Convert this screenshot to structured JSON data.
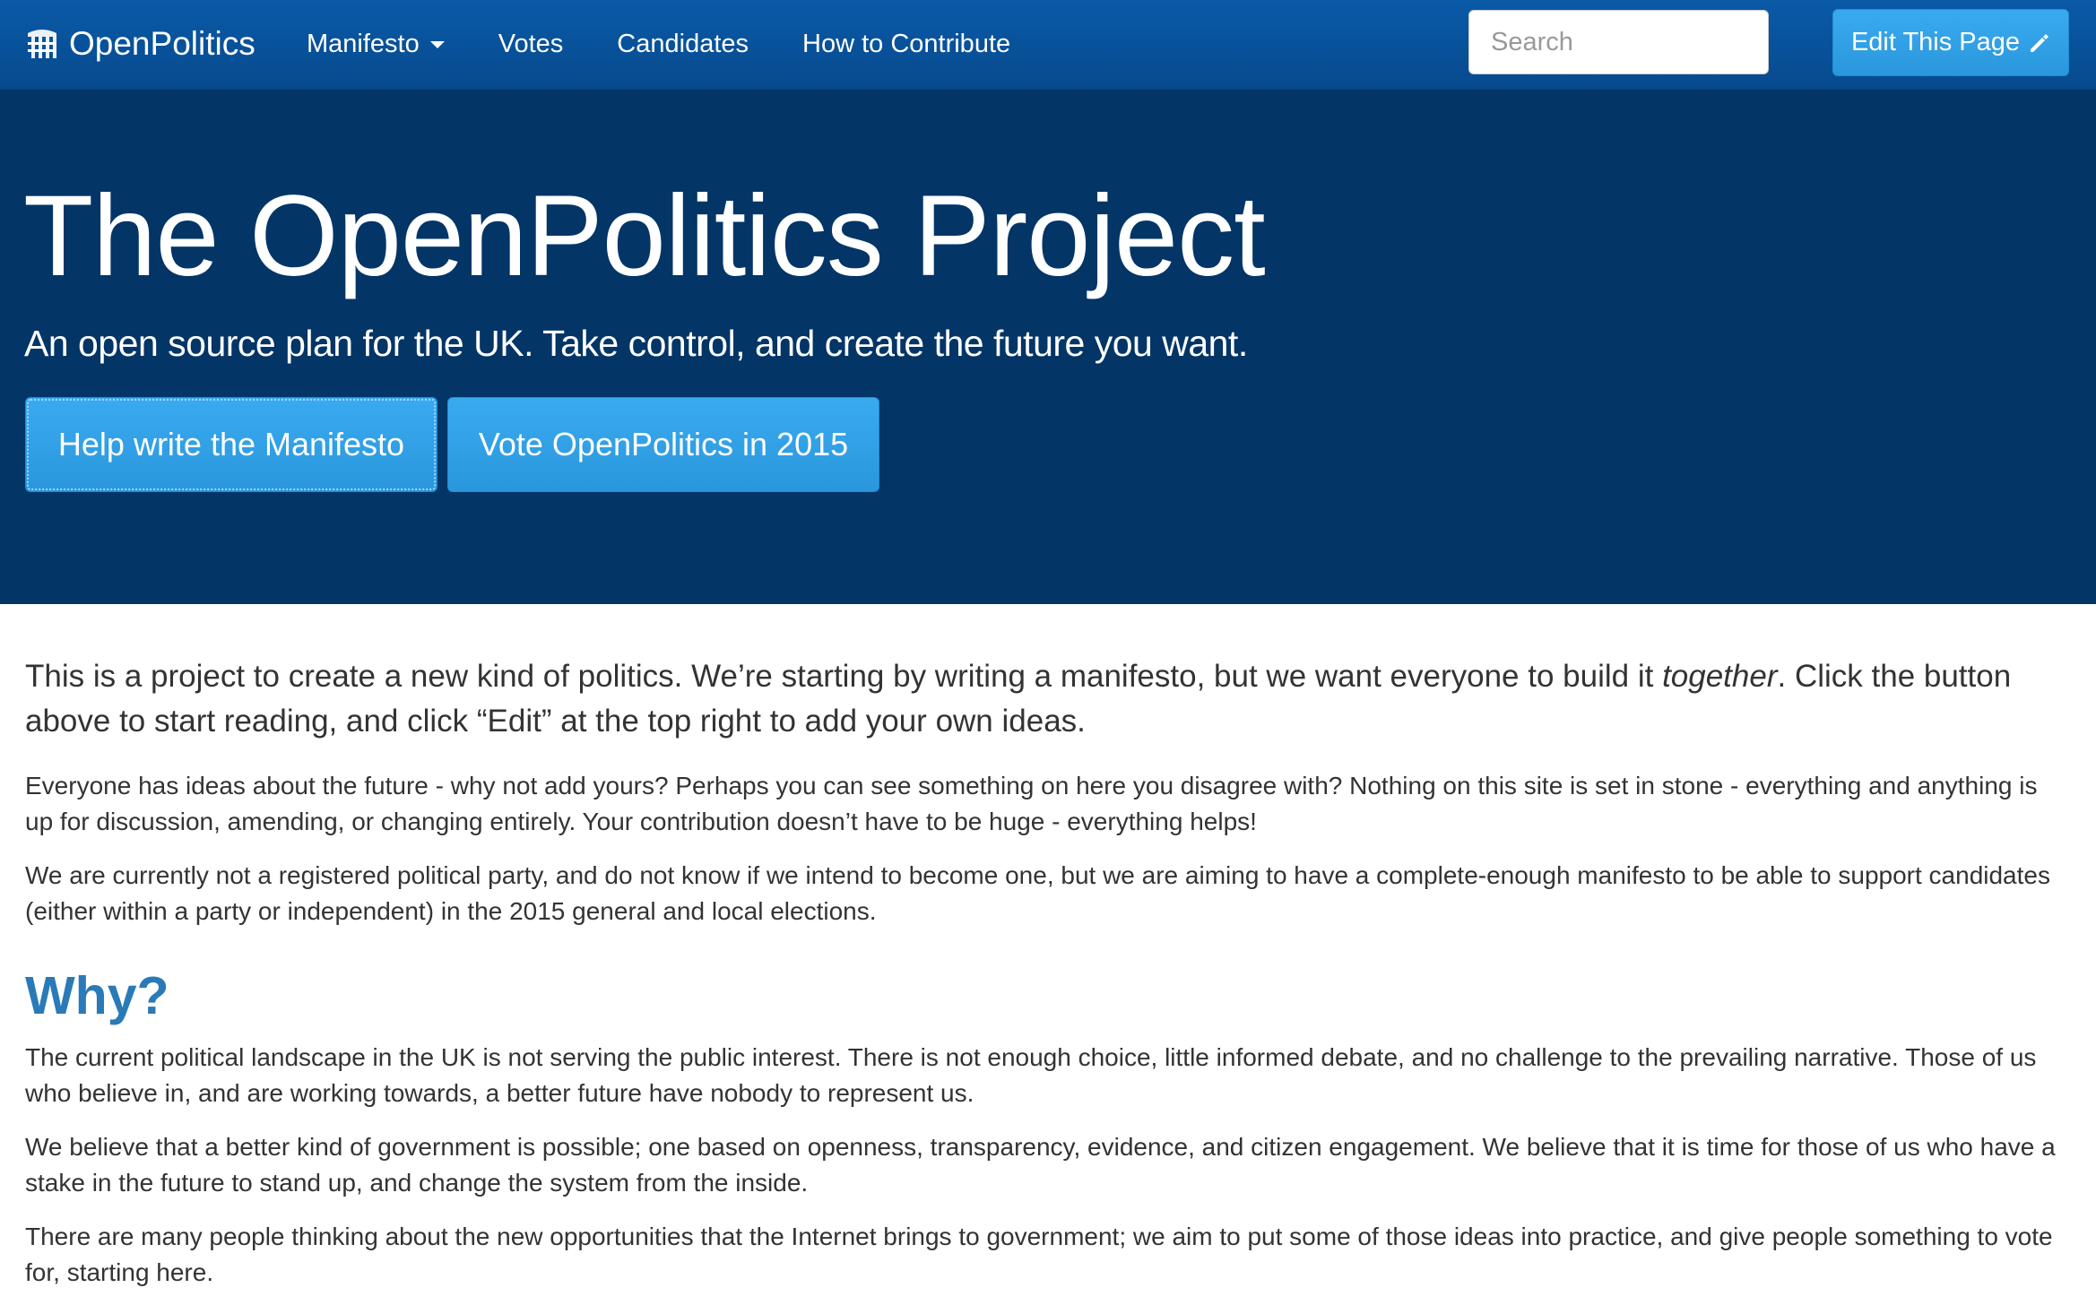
{
  "navbar": {
    "brand": "OpenPolitics",
    "brand_icon": "portcullis-icon",
    "links": [
      {
        "label": "Manifesto",
        "dropdown": true
      },
      {
        "label": "Votes"
      },
      {
        "label": "Candidates"
      },
      {
        "label": "How to Contribute"
      }
    ],
    "search_placeholder": "Search",
    "edit_button": "Edit This Page",
    "edit_icon": "pencil-icon"
  },
  "hero": {
    "title": "The OpenPolitics Project",
    "tagline": "An open source plan for the UK. Take control, and create the future you want.",
    "primary_button": "Help write the Manifesto",
    "secondary_button": "Vote OpenPolitics in 2015"
  },
  "content": {
    "intro": {
      "before": "This is a project to create a new kind of politics. We’re starting by writing a manifesto, but we want everyone to build it ",
      "emphasis": "together",
      "after": ". Click the button above to start reading, and click “Edit” at the top right to add your own ideas."
    },
    "paragraphs": [
      "Everyone has ideas about the future - why not add yours? Perhaps you can see something on here you disagree with? Nothing on this site is set in stone - everything and anything is up for discussion, amending, or changing entirely. Your contribution doesn’t have to be huge - everything helps!",
      "We are currently not a registered political party, and do not know if we intend to become one, but we are aiming to have a complete-enough manifesto to be able to support candidates (either within a party or independent) in the 2015 general and local elections."
    ],
    "why_heading": "Why?",
    "why_paragraphs": [
      "The current political landscape in the UK is not serving the public interest. There is not enough choice, little informed debate, and no challenge to the prevailing narrative. Those of us who believe in, and are working towards, a better future have nobody to represent us.",
      "We believe that a better kind of government is possible; one based on openness, transparency, evidence, and citizen engagement. We believe that it is time for those of us who have a stake in the future to stand up, and change the system from the inside.",
      "There are many people thinking about the new opportunities that the Internet brings to government; we aim to put some of those ideas into practice, and give people something to vote for, starting here."
    ]
  },
  "colors": {
    "navbar": "#0a5aa8",
    "hero_background": "#033567",
    "button": "#3aaaf0",
    "heading_accent": "#2a7ab8"
  }
}
